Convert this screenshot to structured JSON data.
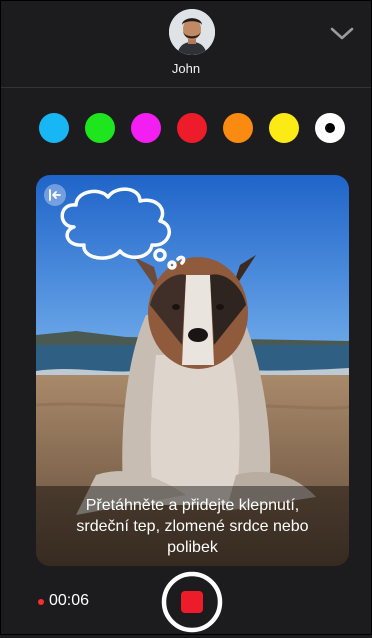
{
  "header": {
    "contact_name": "John",
    "avatar_icon": "person-avatar",
    "collapse_icon": "chevron-down-icon"
  },
  "palette": {
    "colors": [
      "#19b6f5",
      "#1ee51e",
      "#f21ef2",
      "#ee1c2b",
      "#fb8a10",
      "#fbea14",
      "#ffffff"
    ],
    "selected_index": 6
  },
  "canvas": {
    "back_icon": "arrow-left-to-bar-icon",
    "sketch_icon": "thought-bubble-drawing",
    "instruction": "Přetáhněte a přidejte klepnutí, srdeční tep, zlomené srdce nebo polibek"
  },
  "footer": {
    "timer": "00:06",
    "record_icon": "stop-record-icon",
    "record_color": "#ee1c2b"
  }
}
